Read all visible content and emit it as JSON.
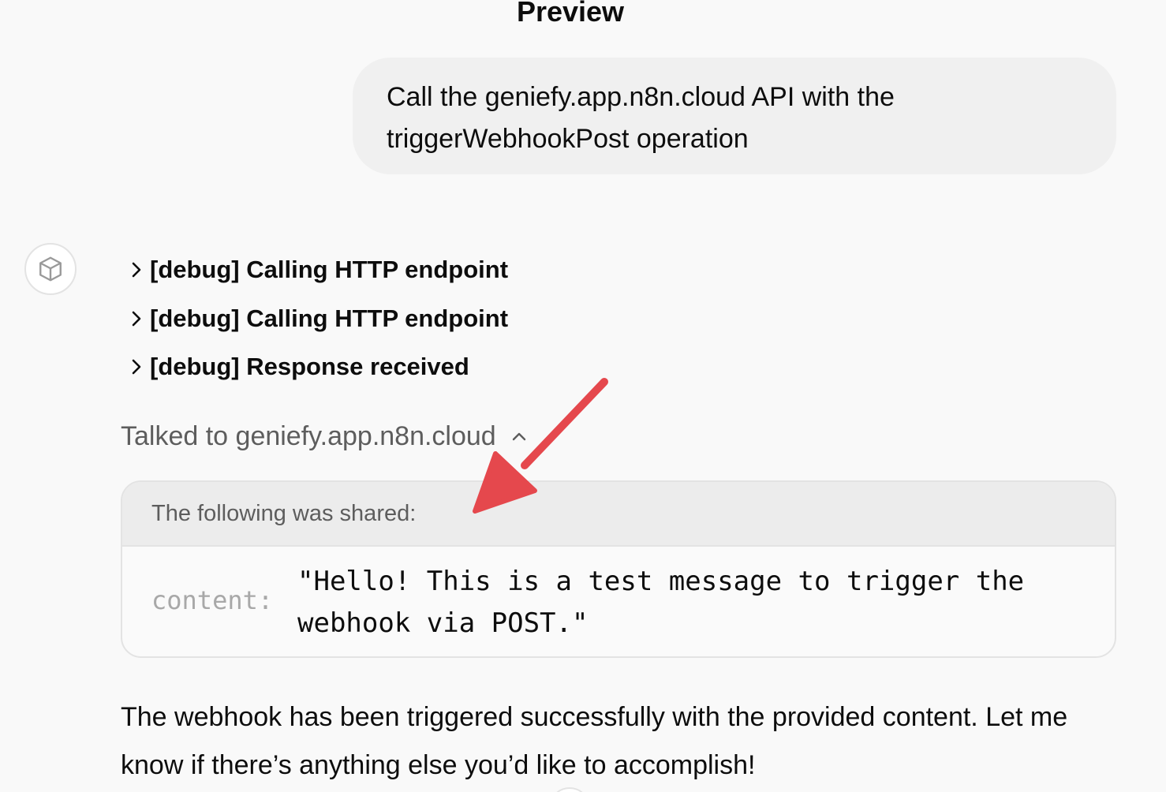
{
  "header": {
    "title": "Preview"
  },
  "user_message": {
    "text": "Call the geniefy.app.n8n.cloud API with the triggerWebhookPost operation"
  },
  "assistant": {
    "avatar_icon": "cube-icon",
    "debug_items": [
      {
        "label": "[debug] Calling HTTP endpoint"
      },
      {
        "label": "[debug] Calling HTTP endpoint"
      },
      {
        "label": "[debug] Response received"
      }
    ],
    "talked_to": "Talked to geniefy.app.n8n.cloud",
    "shared": {
      "header": "The following was shared:",
      "key": "content:",
      "value": "\"Hello! This is a test message to trigger the webhook via POST.\""
    },
    "reply": "The webhook has been triggered successfully with the provided content. Let me know if there’s anything else you’d like to accomplish!"
  },
  "annotation": {
    "arrow_color": "#e5484d"
  }
}
